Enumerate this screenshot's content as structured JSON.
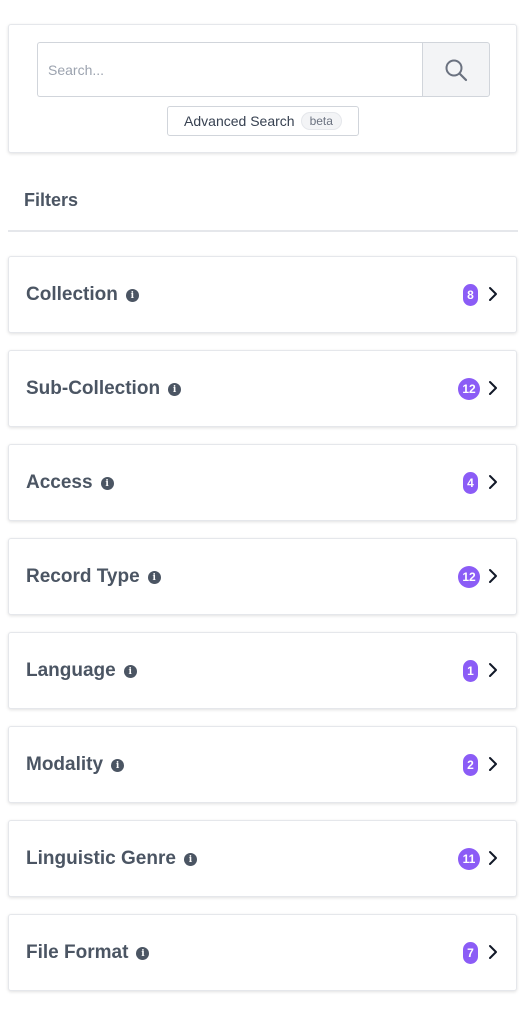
{
  "search": {
    "placeholder": "Search...",
    "button_icon": "search-icon",
    "advanced_label": "Advanced Search",
    "beta_label": "beta"
  },
  "filters": {
    "heading": "Filters",
    "items": [
      {
        "label": "Collection",
        "count": "8"
      },
      {
        "label": "Sub-Collection",
        "count": "12"
      },
      {
        "label": "Access",
        "count": "4"
      },
      {
        "label": "Record Type",
        "count": "12"
      },
      {
        "label": "Language",
        "count": "1"
      },
      {
        "label": "Modality",
        "count": "2"
      },
      {
        "label": "Linguistic Genre",
        "count": "11"
      },
      {
        "label": "File Format",
        "count": "7"
      }
    ]
  },
  "colors": {
    "badge": "#8b5cf6",
    "text": "#4b5563"
  }
}
